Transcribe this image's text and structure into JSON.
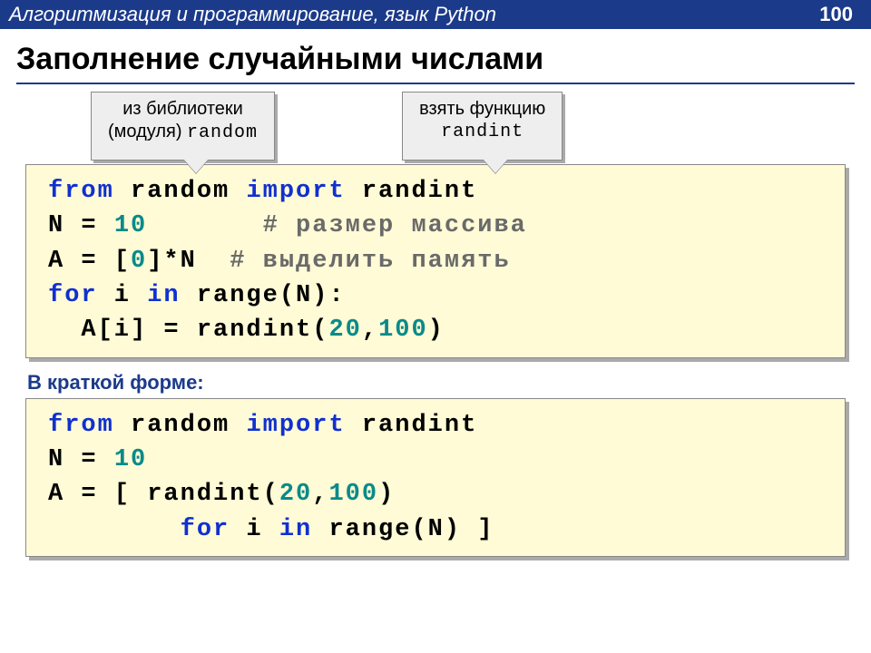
{
  "topbar": {
    "title": "Алгоритмизация и программирование, язык Python",
    "page": "100"
  },
  "slide_title": "Заполнение случайными числами",
  "callouts": {
    "left": {
      "line1": "из библиотеки",
      "line2_pre": "(модуля) ",
      "line2_mono": "random"
    },
    "right": {
      "line1": "взять функцию",
      "line2_mono": "randint"
    }
  },
  "code1": {
    "l1": {
      "from": "from",
      "sp1": " ",
      "random": "random",
      "sp2": " ",
      "import": "import",
      "sp3": " ",
      "randint": "randint"
    },
    "l2": {
      "lhs": "N = ",
      "num": "10",
      "pad": "       ",
      "cmt": "# размер массива"
    },
    "l3": {
      "lhs": "A = [",
      "zero": "0",
      "rhs": "]*N  ",
      "cmt": "# выделить память"
    },
    "l4": {
      "for": "for",
      "sp1": " i ",
      "in": "in",
      "sp2": " ",
      "range": "range",
      "tail": "(N):"
    },
    "l5": {
      "indent": "  A[i] = randint(",
      "a": "20",
      "comma": ",",
      "b": "100",
      "close": ")"
    }
  },
  "subheading": "В краткой форме:",
  "code2": {
    "l1": {
      "from": "from",
      "sp1": " ",
      "random": "random",
      "sp2": " ",
      "import": "import",
      "sp3": " ",
      "randint": "randint"
    },
    "l2": {
      "lhs": "N = ",
      "num": "10"
    },
    "l3": {
      "pre": "A = [ randint(",
      "a": "20",
      "comma": ",",
      "b": "100",
      "close": ")"
    },
    "l4": {
      "indent": "        ",
      "for": "for",
      "sp1": " i ",
      "in": "in",
      "sp2": " ",
      "range": "range",
      "tail": "(N) ]"
    }
  }
}
